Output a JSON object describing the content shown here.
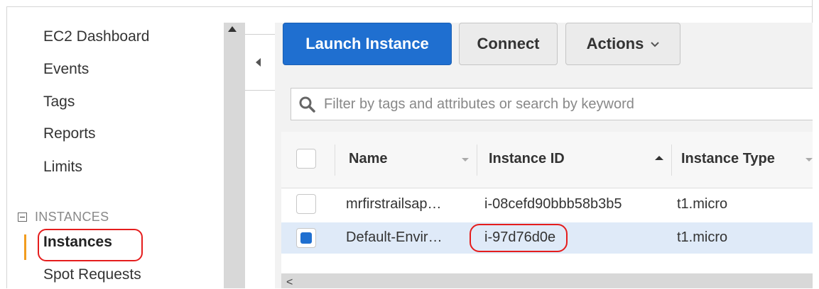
{
  "sidebar": {
    "items": [
      {
        "label": "EC2 Dashboard"
      },
      {
        "label": "Events"
      },
      {
        "label": "Tags"
      },
      {
        "label": "Reports"
      },
      {
        "label": "Limits"
      }
    ],
    "section": {
      "label": "INSTANCES"
    },
    "section_items": [
      {
        "label": "Instances",
        "active": true
      },
      {
        "label": "Spot Requests"
      }
    ]
  },
  "toolbar": {
    "launch_label": "Launch Instance",
    "connect_label": "Connect",
    "actions_label": "Actions"
  },
  "search": {
    "placeholder": "Filter by tags and attributes or search by keyword"
  },
  "table": {
    "columns": [
      "Name",
      "Instance ID",
      "Instance Type"
    ],
    "rows": [
      {
        "name": "mrfirstrailsap…",
        "instance_id": "i-08cefd90bbb58b3b5",
        "instance_type": "t1.micro",
        "selected": false
      },
      {
        "name": "Default-Envir…",
        "instance_id": "i-97d76d0e",
        "instance_type": "t1.micro",
        "selected": true
      }
    ]
  },
  "colors": {
    "primary_button": "#1f6fd0",
    "active_indicator": "#f29c1f",
    "highlight_annotation": "#e51d1d",
    "selected_row": "#dfeaf8"
  },
  "icons": [
    "chevron-up-icon",
    "chevron-left-icon",
    "chevron-down-icon",
    "search-icon",
    "collapse-minus-icon",
    "sort-up-icon",
    "sort-down-icon"
  ]
}
